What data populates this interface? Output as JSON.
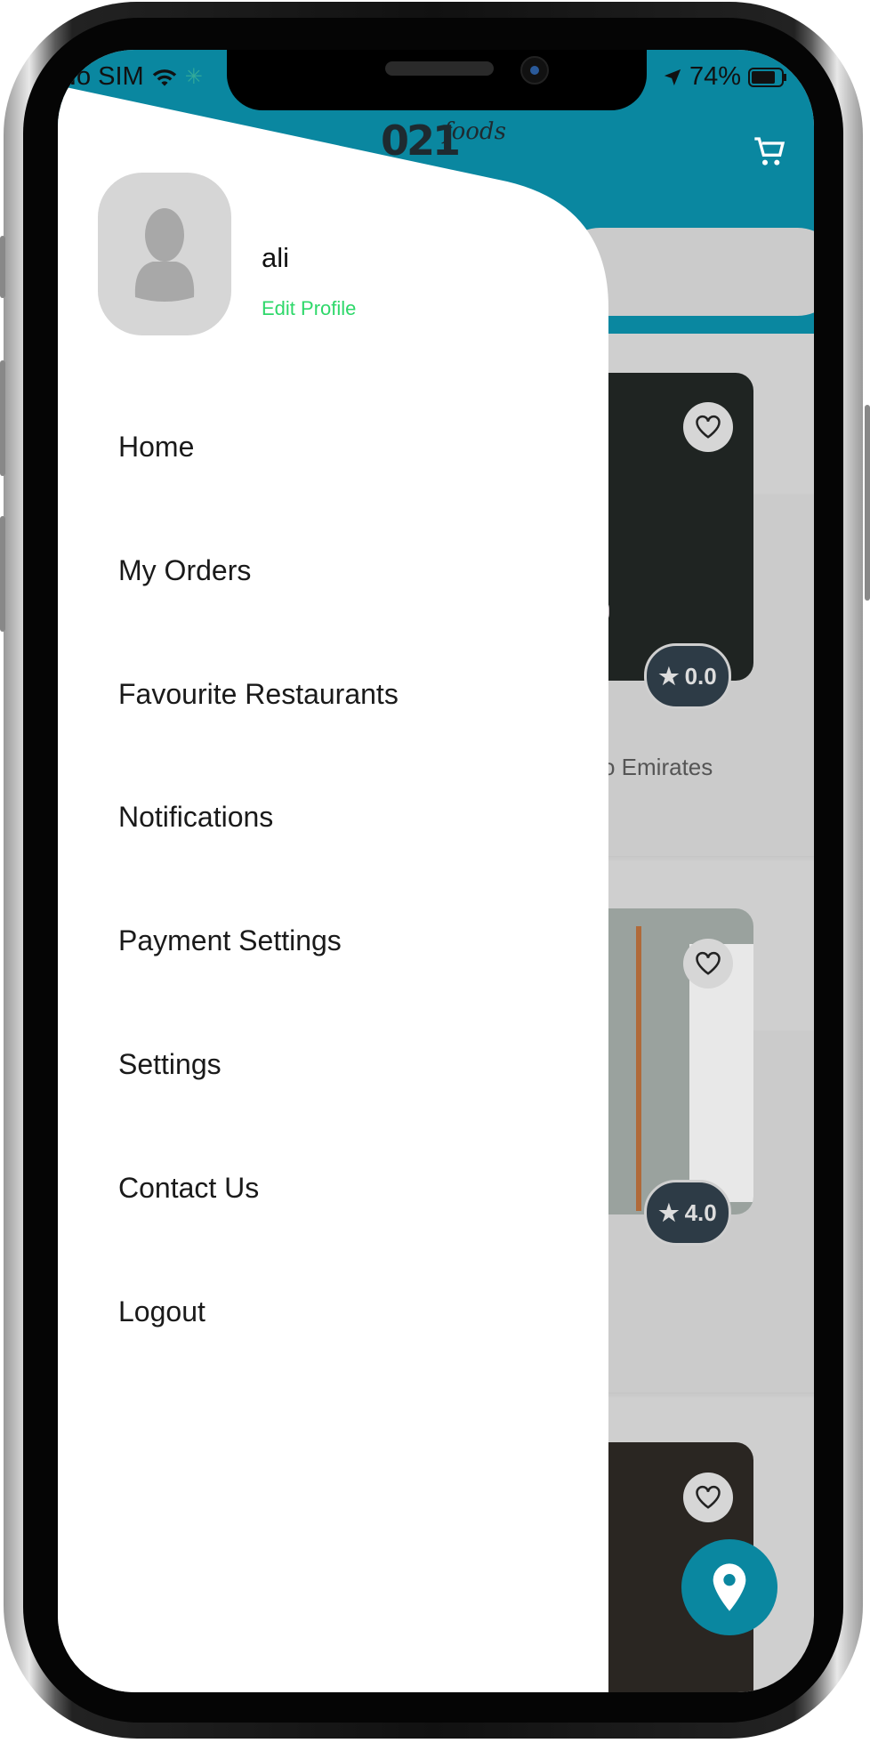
{
  "status_bar": {
    "carrier": "No SIM",
    "battery": "74%"
  },
  "header": {
    "logo_text": "021 foods"
  },
  "drawer": {
    "user_name": "ali",
    "edit_profile": "Edit Profile",
    "items": [
      {
        "label": "Home"
      },
      {
        "label": "My Orders"
      },
      {
        "label": "Favourite Restaurants"
      },
      {
        "label": "Notifications"
      },
      {
        "label": "Payment Settings"
      },
      {
        "label": "Settings"
      },
      {
        "label": "Contact Us"
      },
      {
        "label": "Logout"
      }
    ]
  },
  "restaurants": [
    {
      "rating": "0.0",
      "text_fragment": "o Emirates"
    },
    {
      "rating": "4.0",
      "text_fragment": ""
    },
    {
      "rating": "",
      "text_fragment": ""
    }
  ],
  "colors": {
    "accent": "#0a87a0",
    "edit_profile": "#2ed86a",
    "rating_badge": "#2d3b46"
  }
}
